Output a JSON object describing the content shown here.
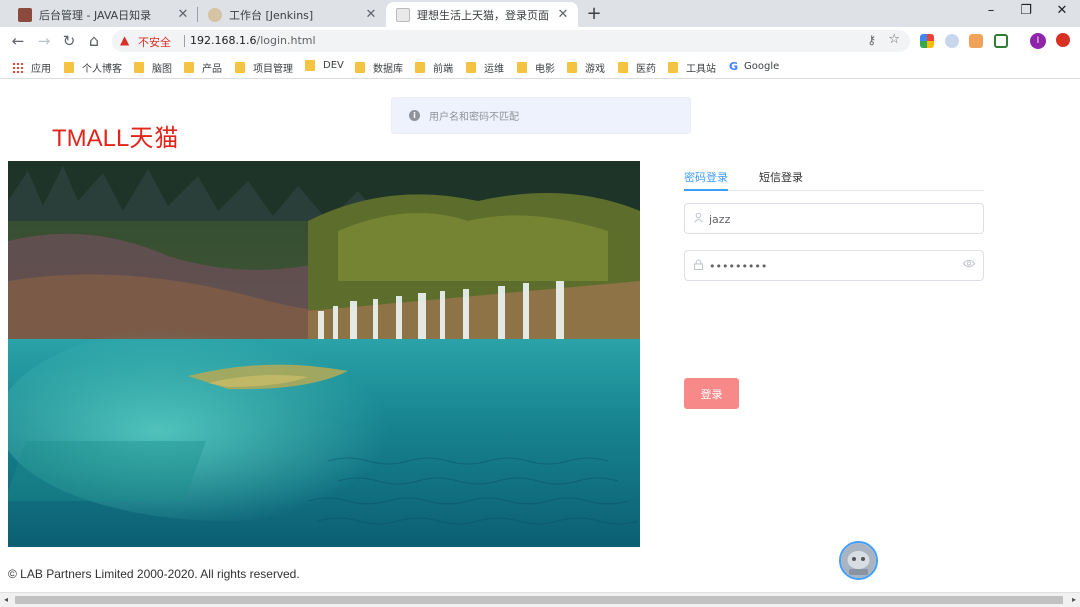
{
  "browser": {
    "tabs": [
      {
        "title": "后台管理 - JAVA日知录",
        "close": "✕"
      },
      {
        "title": "工作台 [Jenkins]",
        "close": "✕"
      },
      {
        "title": "理想生活上天猫，登录页面",
        "close": "✕"
      }
    ],
    "new_tab": "+",
    "window": {
      "minimize": "–",
      "maximize": "❐",
      "close": "✕"
    },
    "nav": {
      "back": "←",
      "forward": "→",
      "reload": "↻",
      "home": "⌂"
    },
    "security_label": "不安全",
    "url_host": "192.168.1.6",
    "url_path": "/login.html",
    "profile_initial": "I",
    "bookmarks": [
      "应用",
      "个人博客",
      "脑图",
      "产品",
      "项目管理",
      "DEV",
      "数据库",
      "前端",
      "运维",
      "电影",
      "游戏",
      "医药",
      "工具站",
      "Google"
    ]
  },
  "page": {
    "logo_latin": "TMALL",
    "logo_cn": "天猫",
    "message": "用户名和密码不匹配",
    "login": {
      "tab_password": "密码登录",
      "tab_sms": "短信登录",
      "username_value": "jazz",
      "password_value": "jazz12345",
      "submit_label": "登录"
    },
    "footer": "© LAB Partners Limited 2000-2020. All rights reserved."
  },
  "colors": {
    "brand_red": "#e1251b",
    "primary_blue": "#409eff",
    "login_button": "#f78989"
  }
}
